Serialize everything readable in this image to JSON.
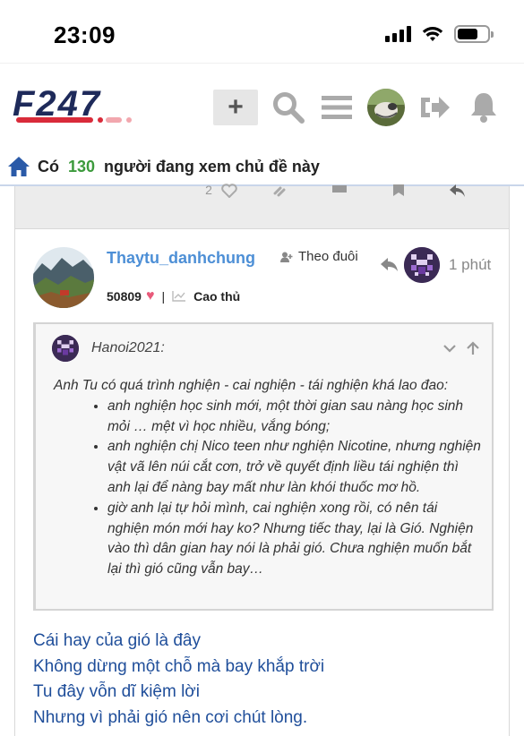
{
  "status_bar": {
    "time": "23:09",
    "battery_level": 0.7
  },
  "header": {
    "logo_text": "F247",
    "new_topic_label": "+",
    "icons": [
      "search-icon",
      "hamburger-menu-icon",
      "user-avatar",
      "logout-icon",
      "notification-bell-icon"
    ]
  },
  "viewers": {
    "prefix": "Có",
    "count": "130",
    "suffix": "người đang xem chủ đề này"
  },
  "prev_post": {
    "like_count": "2"
  },
  "post": {
    "author": "Thaytu_danhchung",
    "follow_label": "Theo đuôi",
    "time": "1 phút",
    "score": "50809",
    "separator": "|",
    "rank": "Cao thủ",
    "quote": {
      "user": "Hanoi2021:",
      "intro": "Anh Tu có quá trình nghiện - cai nghiện - tái nghiện khá lao đao:",
      "items": [
        "anh nghiện học sinh mới, một thời gian sau nàng học sinh mỏi … mệt vì học nhiều, vắng bóng;",
        "anh nghiện chị Nico teen như nghiện Nicotine, nhưng nghiện vật vã lên núi cắt cơn, trở về quyết định liều tái nghiện thì anh lại để nàng bay mất như làn khói thuốc mơ hồ.",
        "giờ anh lại tự hỏi mình, cai nghiện xong rồi, có nên tái nghiện món mới hay ko? Nhưng tiếc thay, lại là Gió. Nghiện vào thì dân gian hay nói là phải gió. Chưa nghiện muốn bắt lại thì gió cũng vẫn bay…"
      ]
    },
    "poem": [
      "Cái hay của gió là đây",
      "Không dừng một chỗ mà bay khắp trời",
      "Tu đây vỗn dĩ kiệm lời",
      "Nhưng vì phải gió nên cơi chút lòng."
    ]
  },
  "colors": {
    "link_blue": "#4d8fd6",
    "poem_blue": "#1f4e9a",
    "viewers_green": "#3c9a3c",
    "logo_navy": "#1e2a5a",
    "logo_red": "#d92b3a",
    "heart_pink": "#e85a7a"
  }
}
